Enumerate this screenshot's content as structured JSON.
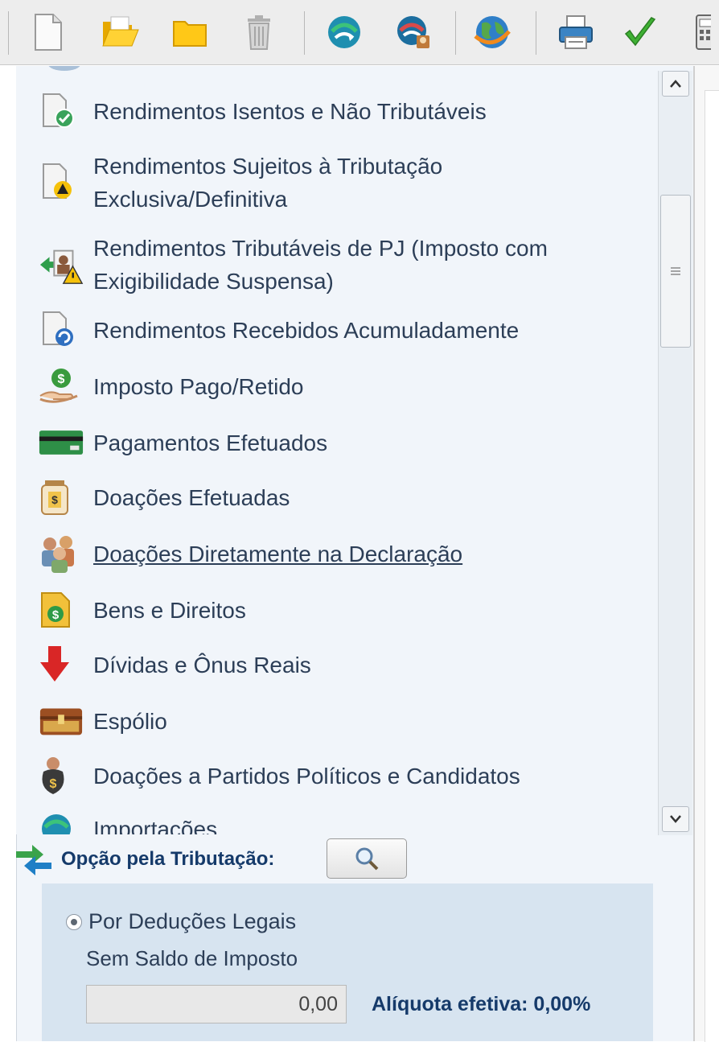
{
  "toolbar": {
    "buttons": [
      {
        "name": "new-document-icon"
      },
      {
        "name": "open-folder-icon"
      },
      {
        "name": "folder-icon"
      },
      {
        "name": "trash-icon"
      },
      {
        "name": "transmit-icon"
      },
      {
        "name": "receipt-icon"
      },
      {
        "name": "globe-icon"
      },
      {
        "name": "printer-icon"
      },
      {
        "name": "checkmark-icon"
      },
      {
        "name": "calculator-icon"
      }
    ]
  },
  "sidebar": {
    "items": [
      {
        "label": "Rendimentos Isentos e Não Tributáveis",
        "icon": "document-check-icon"
      },
      {
        "label": "Rendimentos Sujeitos à Tributação",
        "label2": "Exclusiva/Definitiva",
        "icon": "document-warning-icon"
      },
      {
        "label": "Rendimentos Tributáveis de PJ (Imposto com",
        "label2": "Exigibilidade Suspensa)",
        "icon": "person-warning-icon"
      },
      {
        "label": "Rendimentos Recebidos Acumuladamente",
        "icon": "document-refresh-icon"
      },
      {
        "label": "Imposto Pago/Retido",
        "icon": "hand-coin-icon"
      },
      {
        "label": "Pagamentos Efetuados",
        "icon": "credit-card-icon"
      },
      {
        "label": "Doações Efetuadas",
        "icon": "donation-jar-icon"
      },
      {
        "label": "Doações Diretamente na Declaração",
        "icon": "people-group-icon"
      },
      {
        "label": "Bens e Direitos",
        "icon": "money-document-icon"
      },
      {
        "label": "Dívidas e Ônus Reais",
        "icon": "down-arrow-icon"
      },
      {
        "label": "Espólio",
        "icon": "chest-icon"
      },
      {
        "label": "Doações a Partidos Políticos e Candidatos",
        "icon": "money-bag-icon"
      },
      {
        "label": "Importações",
        "icon": "import-icon"
      }
    ]
  },
  "tax_option": {
    "label": "Opção pela Tributação:",
    "radio_label": "Por Deduções Legais",
    "status": "Sem Saldo de Imposto",
    "value": "0,00",
    "aliquota": "Alíquota efetiva: 0,00%"
  },
  "colors": {
    "accent_text": "#153a6a",
    "body_text": "#2c3e57",
    "panel_bg": "#f1f5fa",
    "option_bg": "#d7e4f0"
  }
}
